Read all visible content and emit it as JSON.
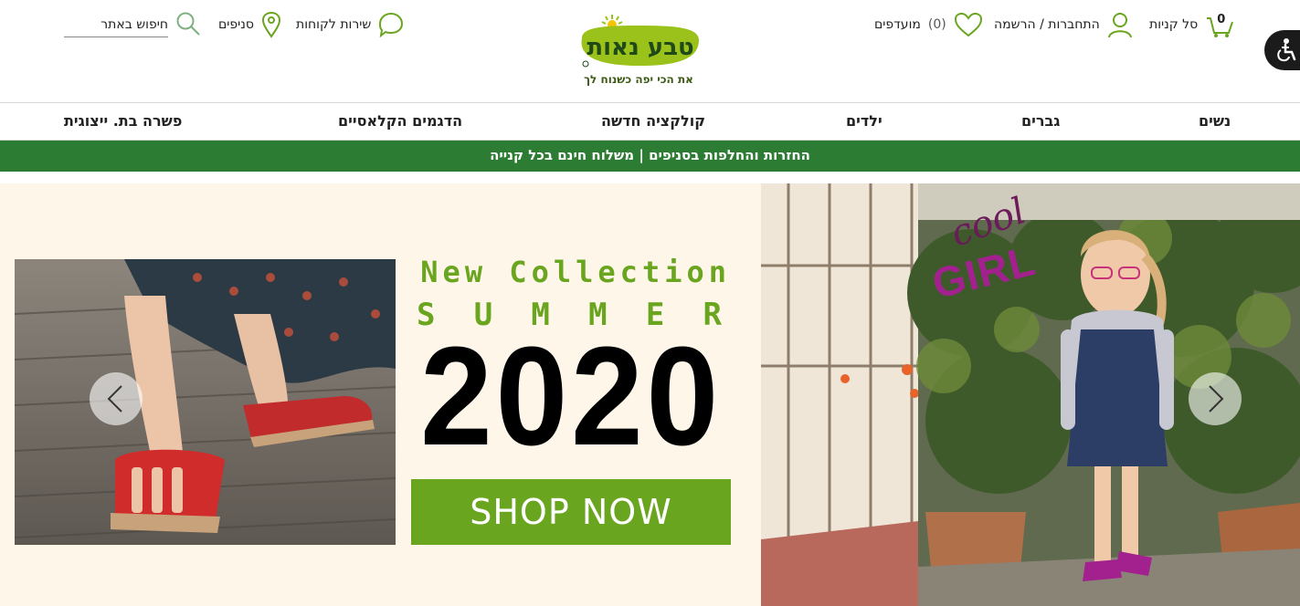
{
  "header": {
    "cart": {
      "label": "סל קניות",
      "count": "0"
    },
    "login": {
      "label": "התחברות / הרשמה"
    },
    "favorites": {
      "count": "(0)",
      "label": "מועדפים"
    },
    "customer_service": {
      "label": "שירות לקוחות"
    },
    "stores": {
      "label": "סניפים"
    },
    "search": {
      "placeholder": "חיפוש באתר"
    },
    "logo": {
      "name": "טבע נאות",
      "tagline": "את הכי יפה כשנוח לך"
    }
  },
  "nav": {
    "items": [
      {
        "label": "נשים"
      },
      {
        "label": "גברים"
      },
      {
        "label": "ילדים"
      },
      {
        "label": "קולקציה חדשה"
      },
      {
        "label": "הדגמים הקלאסיים"
      },
      {
        "label": "פשרה בת. ייצוגית"
      }
    ]
  },
  "promo_strip": {
    "text": "החזרות והחלפות בסניפים | משלוח חינם בכל קנייה"
  },
  "hero": {
    "line1": "New Collection",
    "line2_letters": [
      "S",
      "U",
      "M",
      "M",
      "E",
      "R"
    ],
    "year": "2020",
    "cta": "SHOP NOW",
    "side_text_1": "cool",
    "side_text_2": "GIRL"
  },
  "colors": {
    "brand_green": "#2d7c34",
    "accent_green": "#6aa520",
    "hero_bg": "#fef6e8",
    "girl_text": "#a2218f"
  }
}
